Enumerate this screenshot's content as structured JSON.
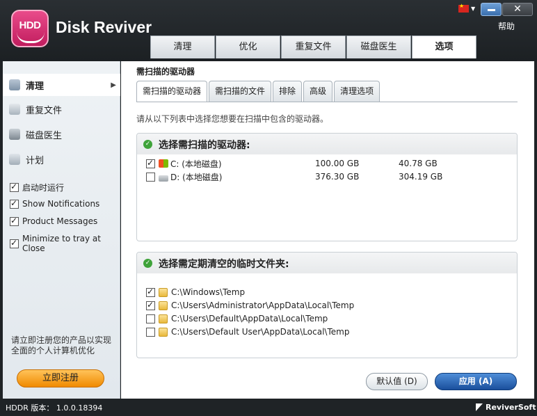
{
  "app": {
    "logo_text": "HDD",
    "title": "Disk Reviver"
  },
  "window": {
    "help": "帮助",
    "close_glyph": "✕"
  },
  "nav": {
    "tabs": [
      "清理",
      "优化",
      "重复文件",
      "磁盘医生",
      "选项"
    ],
    "active": "选项"
  },
  "sidebar": {
    "items": [
      {
        "label": "清理",
        "icon": "broom-icon",
        "active": true
      },
      {
        "label": "重复文件",
        "icon": "duplicate-file-icon",
        "active": false
      },
      {
        "label": "磁盘医生",
        "icon": "stethoscope-icon",
        "active": false
      },
      {
        "label": "计划",
        "icon": "calendar-icon",
        "active": false
      }
    ],
    "checks": [
      {
        "label": "启动时运行",
        "checked": true
      },
      {
        "label": "Show Notifications",
        "checked": true
      },
      {
        "label": "Product Messages",
        "checked": true
      },
      {
        "label": "Minimize to tray at Close",
        "checked": true
      }
    ],
    "note": "请立即注册您的产品以实现全面的个人计算机优化",
    "register": "立即注册"
  },
  "main": {
    "heading": "需扫描的驱动器",
    "subtabs": [
      "需扫描的驱动器",
      "需扫描的文件",
      "排除",
      "高级",
      "清理选项"
    ],
    "instruction": "请从以下列表中选择您想要在扫描中包含的驱动器。",
    "drives_panel": {
      "title": "选择需扫描的驱动器:",
      "rows": [
        {
          "name": "C: (本地磁盘)",
          "size": "100.00 GB",
          "free": "40.78 GB",
          "checked": true,
          "icon": "system-drive-icon"
        },
        {
          "name": "D: (本地磁盘)",
          "size": "376.30 GB",
          "free": "304.19 GB",
          "checked": false,
          "icon": "hard-drive-icon"
        }
      ]
    },
    "temp_panel": {
      "title": "选择需定期清空的临时文件夹:",
      "rows": [
        {
          "path": "C:\\Windows\\Temp",
          "checked": true
        },
        {
          "path": "C:\\Users\\Administrator\\AppData\\Local\\Temp",
          "checked": true
        },
        {
          "path": "C:\\Users\\Default\\AppData\\Local\\Temp",
          "checked": false
        },
        {
          "path": "C:\\Users\\Default User\\AppData\\Local\\Temp",
          "checked": false
        }
      ]
    },
    "default_btn": "默认值 (D)",
    "apply_btn": "应用 (A)"
  },
  "status": {
    "version": "HDDR 版本： 1.0.0.18394",
    "brand": "ReviverSoft"
  },
  "colors": {
    "accent": "#1a4f9c",
    "brand_pink": "#c11d5e",
    "register": "#f08a00",
    "ok_green": "#3fa33a"
  }
}
